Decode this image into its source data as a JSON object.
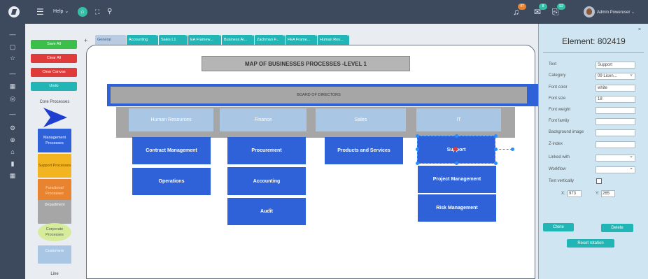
{
  "topbar": {
    "help_label": "Help ⌄",
    "notifications": [
      {
        "name": "alerts",
        "count": "47",
        "color": "#e8832f"
      },
      {
        "name": "messages",
        "count": "8",
        "color": "#33c0a6"
      },
      {
        "name": "tasks",
        "count": "52",
        "color": "#33c0a6"
      }
    ],
    "user": "Admin Poweruser ⌄"
  },
  "palette": {
    "save_all": "Save All",
    "clear_all": "Clear All",
    "clear_canvas": "Clear Canvas",
    "undo": "Undo",
    "core_processes_label": "Core Processes",
    "shapes": [
      {
        "label": "Management Processes",
        "color": "#2f62d8",
        "text_color": "#ffffff"
      },
      {
        "label": "Support Processes",
        "color": "#f2b420",
        "text_color": "#7a4b00"
      },
      {
        "label": "Functional Processes",
        "color": "#e8832f",
        "text_color": "#fbe0c8"
      },
      {
        "label": "Department",
        "color": "#a6a6a6",
        "text_color": "#ffffff"
      },
      {
        "label": "Corporate Processes",
        "color": "#d6ec9a",
        "text_color": "#555555"
      },
      {
        "label": "Customers",
        "color": "#a9c6e4",
        "text_color": "#ffffff"
      }
    ],
    "line_label": "Line"
  },
  "tabs": [
    {
      "label": "General",
      "active": true
    },
    {
      "label": "Accounting"
    },
    {
      "label": "Sales L1"
    },
    {
      "label": "EA Framew..."
    },
    {
      "label": "Business Ar..."
    },
    {
      "label": "Zachman F..."
    },
    {
      "label": "FEA Frame..."
    },
    {
      "label": "Human Res..."
    }
  ],
  "canvas": {
    "title": "MAP OF BUSINESSES PROCESSES -LEVEL 1",
    "board": "BOARD OF DIRECTORS",
    "departments": [
      "Human Resources",
      "Finance",
      "Sales",
      "IT"
    ],
    "processes": {
      "hr": [
        "Contract Management",
        "Operations"
      ],
      "finance": [
        "Procurement",
        "Accounting",
        "Audit"
      ],
      "sales": [
        "Products and Services"
      ],
      "it": [
        "Support",
        "Project Management",
        "Risk Management"
      ]
    }
  },
  "properties": {
    "title": "Element: 802419",
    "labels": {
      "text": "Text",
      "category": "Category",
      "font_color": "Font color",
      "font_size": "Font size",
      "font_weight": "Font weight",
      "font_family": "Font family",
      "background_image": "Background image",
      "z_index": "Z-index",
      "linked_with": "Linked with",
      "workflow": "Workflow",
      "text_vertically": "Text vertically"
    },
    "values": {
      "text": "Support",
      "category": "09 Licen...",
      "font_color": "white",
      "font_size": "18",
      "font_weight": "",
      "font_family": "",
      "background_image": "",
      "z_index": "",
      "linked_with": "",
      "workflow": ""
    },
    "x_label": "X:",
    "x_value": "973",
    "y_label": "Y:",
    "y_value": "265",
    "clone": "Clone",
    "delete": "Delete",
    "reset_rotation": "Reset rotation"
  }
}
